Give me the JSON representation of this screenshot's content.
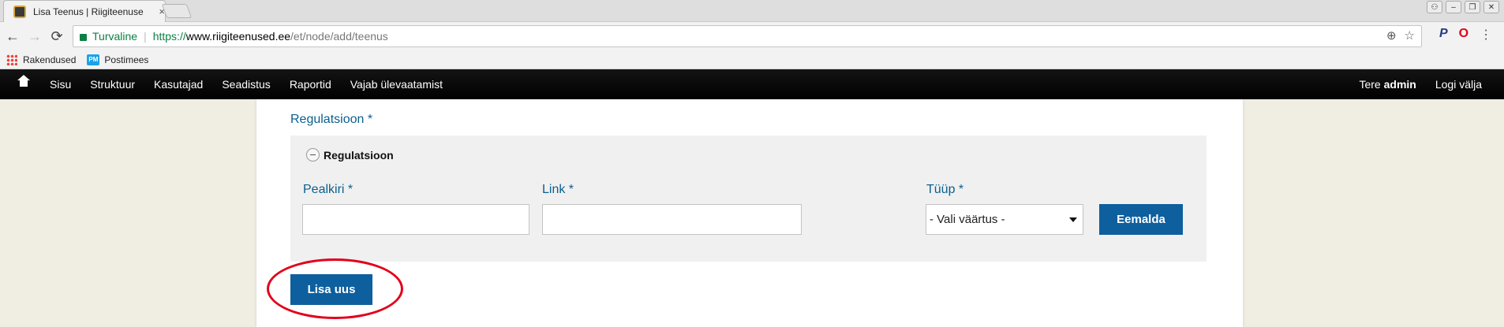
{
  "browser": {
    "tab_title": "Lisa Teenus | Riigiteenuse",
    "tab_close": "×",
    "security_label": "Turvaline",
    "url_scheme": "https://",
    "url_host": "www.riigiteenused.ee",
    "url_path": "/et/node/add/teenus",
    "bookmarks": [
      {
        "label": "Rakendused",
        "icon": "apps-icon"
      },
      {
        "label": "Postimees",
        "icon": "postimees-icon",
        "icon_text": "PM"
      }
    ],
    "nav": {
      "back": "←",
      "forward": "→",
      "reload": "⟳"
    },
    "omnibox_icons": {
      "zoom": "⊕",
      "star": "☆"
    },
    "extensions": {
      "paypal": "P",
      "opera": "O",
      "menu": "⋮"
    },
    "window_controls": {
      "user": "⚇",
      "minimize": "–",
      "restore": "❐",
      "close": "✕"
    }
  },
  "admin_menu": {
    "items": [
      "Sisu",
      "Struktuur",
      "Kasutajad",
      "Seadistus",
      "Raportid",
      "Vajab ülevaatamist"
    ],
    "greeting_prefix": "Tere ",
    "username": "admin",
    "logout": "Logi välja"
  },
  "form": {
    "section_label": "Regulatsioon *",
    "fieldset_legend": "Regulatsioon",
    "fields": {
      "title_label": "Pealkiri *",
      "title_value": "",
      "link_label": "Link *",
      "link_value": "",
      "type_label": "Tüüp *",
      "type_selected": "- Vali väärtus -"
    },
    "remove_button": "Eemalda",
    "add_button": "Lisa uus"
  },
  "colors": {
    "label_blue": "#0b5f8e",
    "button_blue": "#0e5f9e",
    "highlight_red": "#e2001a",
    "secure_green": "#0b8043"
  }
}
